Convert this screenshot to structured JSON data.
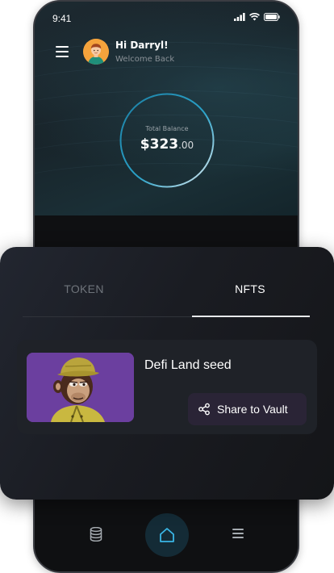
{
  "status_bar": {
    "time": "9:41",
    "icons": [
      "signal-icon",
      "wifi-icon",
      "battery-icon"
    ]
  },
  "header": {
    "greeting": "Hi Darryl!",
    "subtitle": "Welcome Back",
    "menu_icon": "hamburger-menu-icon",
    "avatar": "user-avatar"
  },
  "balance": {
    "label": "Total Balance",
    "amount_main": "$323",
    "amount_cents": ".00"
  },
  "tabs": [
    {
      "label": "TOKEN",
      "active": false
    },
    {
      "label": "NFTS",
      "active": true
    }
  ],
  "nfts": [
    {
      "name": "Defi Land seed",
      "image": "ape-nft-image",
      "action_label": "Share to Vault",
      "action_icon": "share-icon"
    }
  ],
  "bottom_nav": {
    "items": [
      {
        "icon": "database-icon"
      },
      {
        "icon": "home-icon",
        "active": true
      },
      {
        "icon": "list-icon"
      }
    ]
  },
  "colors": {
    "accent": "#2a8fb0",
    "active_nav_bg": "#142b36",
    "nft_bg": "#6a3f9c",
    "share_button_bg": "#2a2436"
  }
}
